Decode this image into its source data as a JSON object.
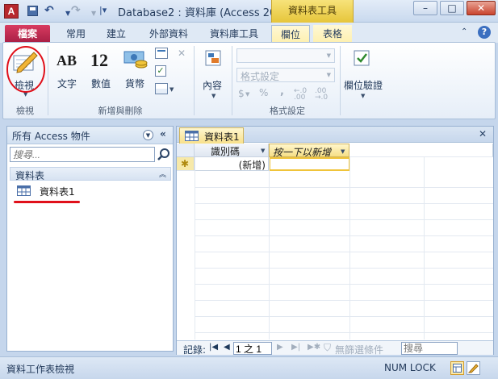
{
  "titlebar": {
    "app_icon_letter": "A",
    "title": "Database2 : 資料庫 (Access 20...",
    "contextual_header": "資料表工具",
    "minimize": "–",
    "maximize": "□",
    "close": "✕"
  },
  "tabs": [
    {
      "label": "檔案"
    },
    {
      "label": "常用"
    },
    {
      "label": "建立"
    },
    {
      "label": "外部資料"
    },
    {
      "label": "資料庫工具"
    },
    {
      "label": "欄位"
    },
    {
      "label": "表格"
    }
  ],
  "ribbon": {
    "views_group": {
      "button": "檢視",
      "label": "檢視"
    },
    "add_delete_group": {
      "label": "新增與刪除",
      "text_btn": "文字",
      "text_icon": "AB",
      "number_btn": "數值",
      "number_icon": "12",
      "currency_btn": "貨幣"
    },
    "properties_group": {
      "button": "內容"
    },
    "formatting_group": {
      "label": "格式設定",
      "data_type_placeholder": "",
      "format_placeholder": "格式設定",
      "percent": "%",
      "comma": ","
    },
    "validation_group": {
      "button": "欄位驗證"
    }
  },
  "navpane": {
    "title": "所有 Access 物件",
    "search_placeholder": "搜尋...",
    "category": "資料表",
    "items": [
      {
        "label": "資料表1"
      }
    ]
  },
  "document": {
    "tab_label": "資料表1",
    "columns": [
      {
        "label": "識別碼"
      },
      {
        "label": "按一下以新增"
      }
    ],
    "new_row_marker": "✱",
    "new_row_value": "(新增)",
    "record_nav": {
      "label": "記錄:",
      "position": "1 之 1",
      "filter": "無篩選條件",
      "search": "搜尋"
    }
  },
  "statusbar": {
    "left": "資料工作表檢視",
    "numlock": "NUM LOCK"
  },
  "colors": {
    "accent": "#b7282e",
    "file_tab": "#c02a50",
    "contextual": "#f2d65a",
    "annotation": "#e0101a"
  }
}
